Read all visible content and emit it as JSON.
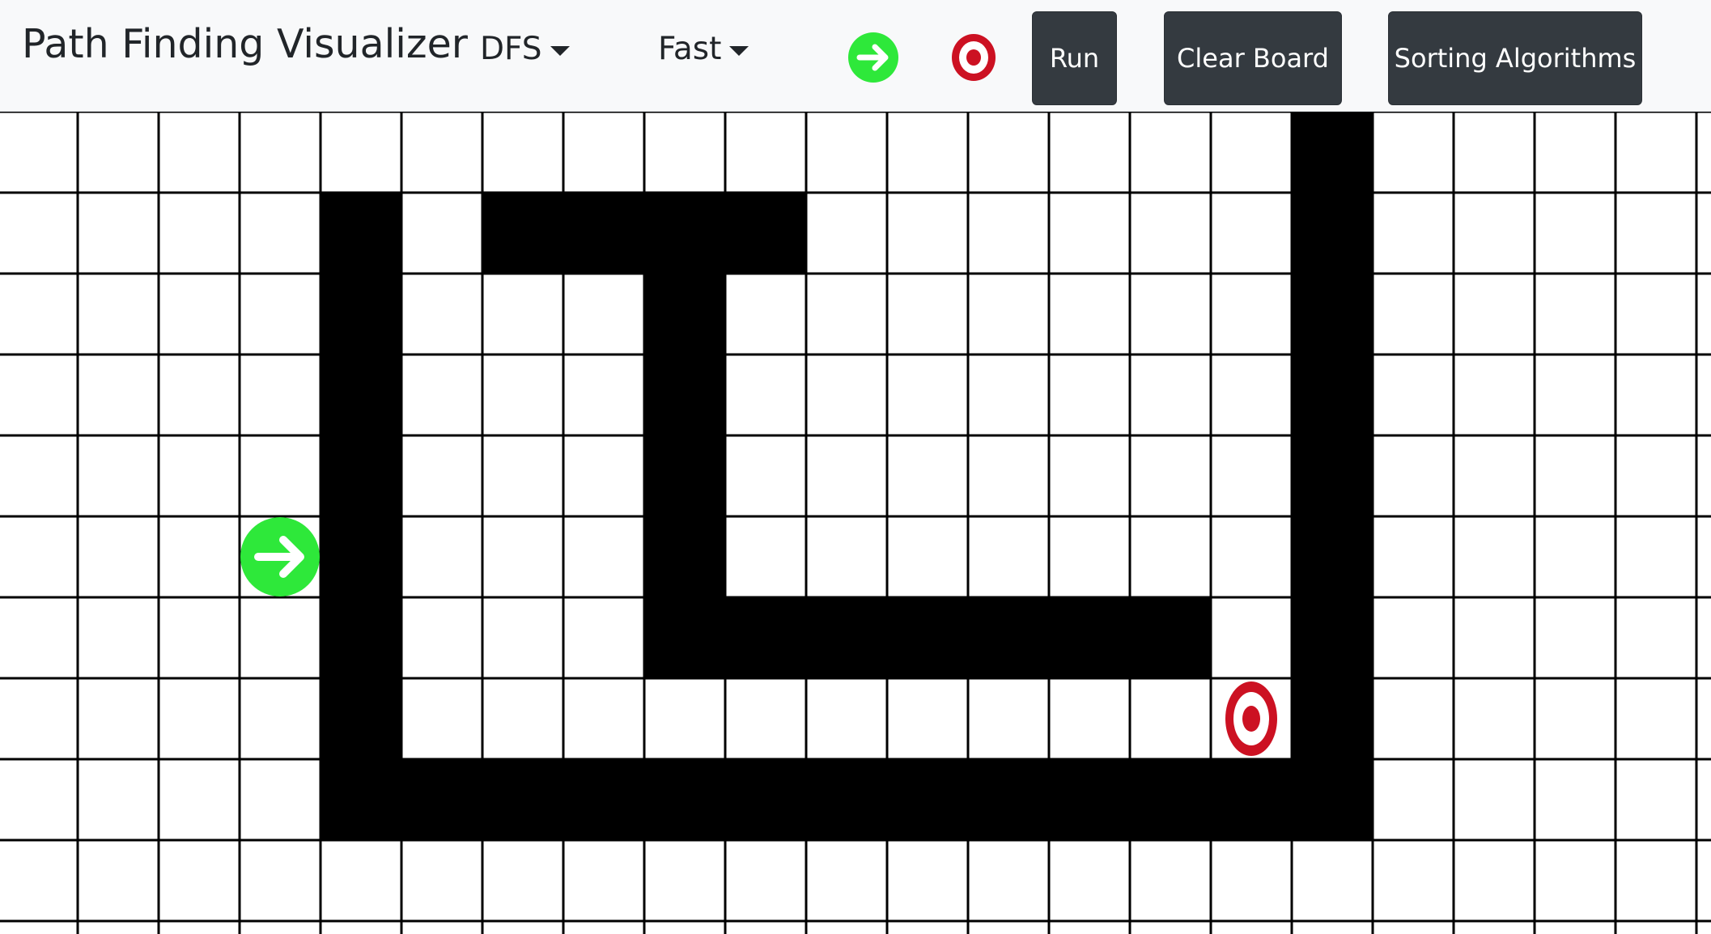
{
  "header": {
    "title": "Path Finding Visualizer",
    "algorithm_selected": "DFS",
    "speed_selected": "Fast",
    "start_tool_icon": "start-arrow-icon",
    "target_tool_icon": "target-icon",
    "run_label": "Run",
    "clear_label": "Clear Board",
    "sorting_label": "Sorting Algorithms"
  },
  "colors": {
    "navbar_bg": "#f8f9fa",
    "button_bg": "#343a40",
    "wall": "#000000",
    "start": "#2ee83a",
    "target": "#cc1122",
    "grid_line": "#000000"
  },
  "grid": {
    "walls": [
      [
        1,
        4
      ],
      [
        2,
        4
      ],
      [
        3,
        4
      ],
      [
        4,
        4
      ],
      [
        5,
        4
      ],
      [
        6,
        4
      ],
      [
        7,
        4
      ],
      [
        8,
        4
      ],
      [
        1,
        6
      ],
      [
        1,
        7
      ],
      [
        1,
        8
      ],
      [
        1,
        9
      ],
      [
        2,
        8
      ],
      [
        3,
        8
      ],
      [
        4,
        8
      ],
      [
        5,
        8
      ],
      [
        6,
        8
      ],
      [
        6,
        9
      ],
      [
        6,
        10
      ],
      [
        6,
        11
      ],
      [
        6,
        12
      ],
      [
        6,
        13
      ],
      [
        6,
        14
      ],
      [
        8,
        5
      ],
      [
        8,
        6
      ],
      [
        8,
        7
      ],
      [
        8,
        8
      ],
      [
        8,
        9
      ],
      [
        8,
        10
      ],
      [
        8,
        11
      ],
      [
        8,
        12
      ],
      [
        8,
        13
      ],
      [
        8,
        14
      ],
      [
        8,
        15
      ],
      [
        8,
        16
      ],
      [
        0,
        16
      ],
      [
        1,
        16
      ],
      [
        2,
        16
      ],
      [
        3,
        16
      ],
      [
        4,
        16
      ],
      [
        5,
        16
      ],
      [
        6,
        16
      ],
      [
        7,
        16
      ]
    ],
    "start": [
      5,
      3
    ],
    "target": [
      7,
      15
    ]
  }
}
